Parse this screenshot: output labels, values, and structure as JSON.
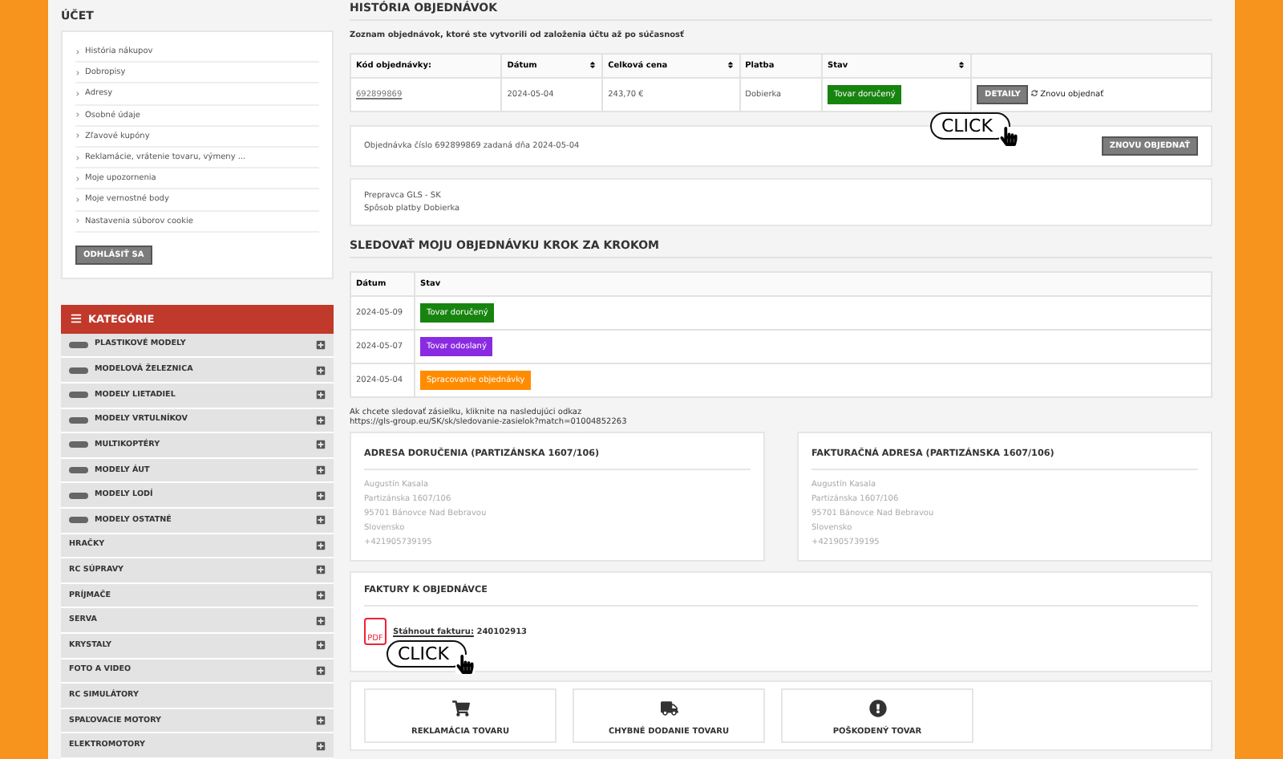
{
  "account": {
    "title": "ÚČET",
    "links": [
      "História nákupov",
      "Dobropisy",
      "Adresy",
      "Osobné údaje",
      "Zľavové kupóny",
      "Reklamácie, vrátenie tovaru, výmeny ...",
      "Moje upozornenia",
      "Moje vernostné body",
      "Nastavenia súborov cookie"
    ],
    "logout": "ODHLÁSIŤ SA"
  },
  "categories": {
    "title": "KATEGÓRIE",
    "items": [
      {
        "label": "PLASTIKOVÉ MODELY",
        "thumb": true,
        "expandable": true
      },
      {
        "label": "MODELOVÁ ŽELEZNICA",
        "thumb": true,
        "expandable": true
      },
      {
        "label": "MODELY LIETADIEL",
        "thumb": true,
        "expandable": true
      },
      {
        "label": "MODELY VRTULNÍKOV",
        "thumb": true,
        "expandable": true
      },
      {
        "label": "MULTIKOPTÉRY",
        "thumb": true,
        "expandable": true
      },
      {
        "label": "MODELY ÁUT",
        "thumb": true,
        "expandable": true
      },
      {
        "label": "MODELY LODÍ",
        "thumb": true,
        "expandable": true
      },
      {
        "label": "MODELY OSTATNÉ",
        "thumb": true,
        "expandable": true
      },
      {
        "label": "HRAČKY",
        "thumb": false,
        "expandable": true
      },
      {
        "label": "RC SÚPRAVY",
        "thumb": false,
        "expandable": true
      },
      {
        "label": "PRÍJMAČE",
        "thumb": false,
        "expandable": true
      },
      {
        "label": "SERVA",
        "thumb": false,
        "expandable": true
      },
      {
        "label": "KRYSTALY",
        "thumb": false,
        "expandable": true
      },
      {
        "label": "FOTO A VIDEO",
        "thumb": false,
        "expandable": true
      },
      {
        "label": "RC SIMULÁTORY",
        "thumb": false,
        "expandable": false
      },
      {
        "label": "SPAĽOVACIE MOTORY",
        "thumb": false,
        "expandable": true
      },
      {
        "label": "ELEKTROMOTORY",
        "thumb": false,
        "expandable": true
      }
    ]
  },
  "history": {
    "title": "HISTÓRIA OBJEDNÁVOK",
    "intro": "Zoznam objednávok, ktoré ste vytvorili od založenia účtu až po súčasnosť",
    "columns": [
      {
        "label": "Kód objednávky:",
        "sortable": false
      },
      {
        "label": "Dátum",
        "sortable": true
      },
      {
        "label": "Celková cena",
        "sortable": true
      },
      {
        "label": "Platba",
        "sortable": false
      },
      {
        "label": "Stav",
        "sortable": true
      }
    ],
    "row": {
      "code": "692899869",
      "date": "2024-05-04",
      "price": "243,70 €",
      "payment": "Dobierka",
      "status": "Tovar doručený",
      "color": "#17840f",
      "details": "DETAILY",
      "reorder": "Znovu objednať"
    },
    "order_line": "Objednávka číslo 692899869 zadaná dňa 2024-05-04",
    "reorder_button": "ZNOVU OBJEDNAŤ",
    "carrier": "Prepravca GLS - SK",
    "payment_method": "Spôsob platby Dobierka"
  },
  "tracking": {
    "title": "SLEDOVAŤ MOJU OBJEDNÁVKU KROK ZA KROKOM",
    "columns": [
      "Dátum",
      "Stav"
    ],
    "rows": [
      {
        "date": "2024-05-09",
        "status": "Tovar doručený",
        "color": "#17840f"
      },
      {
        "date": "2024-05-07",
        "status": "Tovar odoslaný",
        "color": "#8a2be2"
      },
      {
        "date": "2024-05-04",
        "status": "Spracovanie objednávky",
        "color": "#ff8c00"
      }
    ],
    "note": "Ak chcete sledovať zásielku, kliknite na nasledujúci odkaz",
    "link": "https://gls-group.eu/SK/sk/sledovanie-zasielok?match=01004852263"
  },
  "addresses": [
    {
      "title": "ADRESA DORUČENIA (PARTIZÁNSKA 1607/106)",
      "lines": [
        "Augustín Kasala",
        "Partizánska 1607/106",
        "95701 Bánovce Nad Bebravou",
        "Slovensko",
        "+421905739195"
      ]
    },
    {
      "title": "FAKTURAČNÁ ADRESA (PARTIZÁNSKA 1607/106)",
      "lines": [
        "Augustín Kasala",
        "Partizánska 1607/106",
        "95701 Bánovce Nad Bebravou",
        "Slovensko",
        "+421905739195"
      ]
    }
  ],
  "invoices": {
    "title": "FAKTURY K OBJEDNÁVCE",
    "label": "Stáhnout fakturu:",
    "number": "240102913",
    "icon_text": "PDF"
  },
  "actions": [
    {
      "kind": "cart",
      "label": "REKLAMÁCIA TOVARU"
    },
    {
      "kind": "truck",
      "label": "CHYBNÉ DODANIE TOVARU"
    },
    {
      "kind": "alert",
      "label": "POŠKODENÝ TOVAR"
    }
  ],
  "callouts": [
    "CLICK",
    "CLICK"
  ]
}
